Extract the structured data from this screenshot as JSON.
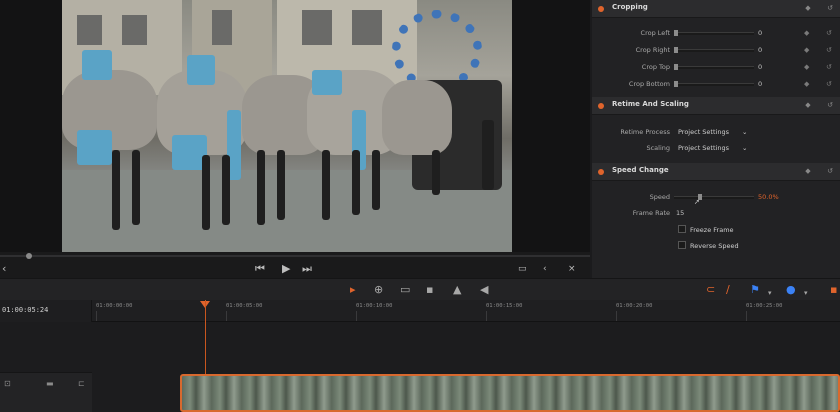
{
  "inspector": {
    "cropping": {
      "title": "Cropping",
      "rows": [
        {
          "label": "Crop Left",
          "value": "0"
        },
        {
          "label": "Crop Right",
          "value": "0"
        },
        {
          "label": "Crop Top",
          "value": "0"
        },
        {
          "label": "Crop Bottom",
          "value": "0"
        }
      ]
    },
    "retime": {
      "title": "Retime And Scaling",
      "retime_process_label": "Retime Process",
      "retime_process_value": "Project Settings",
      "scaling_label": "Scaling",
      "scaling_value": "Project Settings"
    },
    "speed": {
      "title": "Speed Change",
      "speed_label": "Speed",
      "speed_value": "50.0%",
      "speed_fraction": 0.3,
      "frame_rate_label": "Frame Rate",
      "frame_rate_value": "15",
      "freeze_frame": "Freeze Frame",
      "reverse_speed": "Reverse Speed"
    }
  },
  "timeline": {
    "timecode": "01:00:05:24",
    "ruler_ticks": [
      "01:00:00:00",
      "01:00:05:00",
      "01:00:10:00",
      "01:00:15:00",
      "01:00:20:00",
      "01:00:25:00"
    ]
  },
  "colors": {
    "accent": "#e0642c",
    "blue": "#3b82f6",
    "panel": "#222224"
  }
}
